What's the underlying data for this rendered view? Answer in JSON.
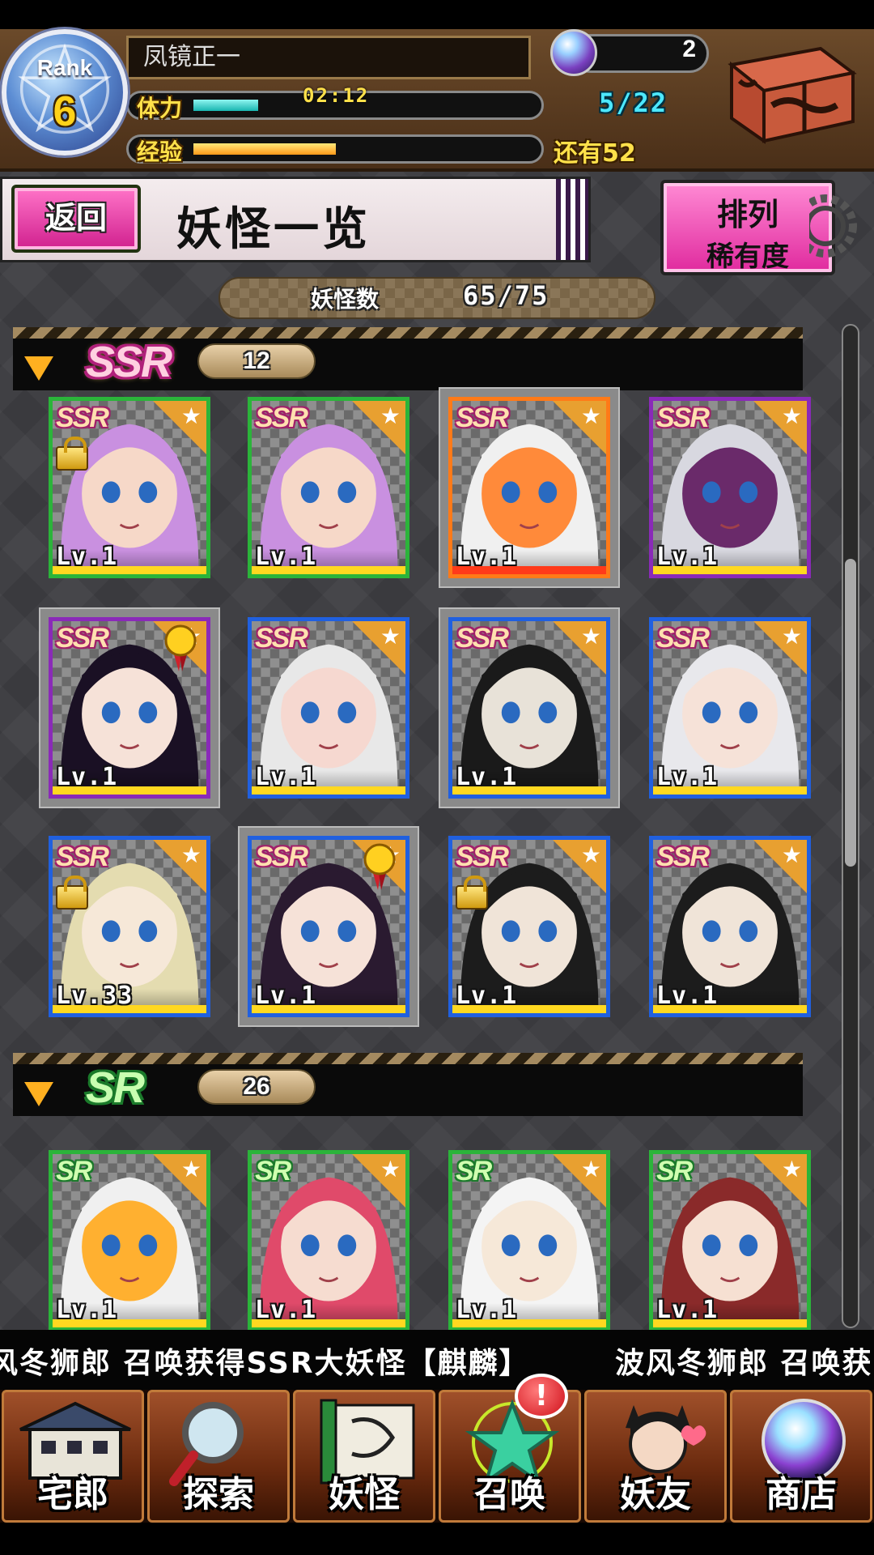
{
  "player": {
    "rank_label": "Rank",
    "rank_value": "6",
    "name": "凤镜正一",
    "stamina_label": "体力",
    "stamina_timer": "02:12",
    "stamina_fraction": 0.19,
    "exp_label": "经验",
    "exp_fraction": 0.42,
    "gems": "2",
    "summon_tickets": "5/22",
    "exp_remaining": "还有52"
  },
  "nav_top": {
    "back_label": "返回",
    "title": "妖怪一览",
    "sort_label_1": "排列",
    "sort_label_2": "稀有度"
  },
  "collection": {
    "label": "妖怪数",
    "value": "65/75"
  },
  "sections": [
    {
      "rarity": "SSR",
      "count": "12",
      "cards": [
        {
          "tag": "SSR",
          "level": "Lv.1",
          "frame": "green",
          "locked": true,
          "medal": false,
          "selected": false
        },
        {
          "tag": "SSR",
          "level": "Lv.1",
          "frame": "green",
          "locked": false,
          "medal": false,
          "selected": false
        },
        {
          "tag": "SSR",
          "level": "Lv.1",
          "frame": "orange",
          "locked": false,
          "medal": false,
          "selected": true
        },
        {
          "tag": "SSR",
          "level": "Lv.1",
          "frame": "purple",
          "locked": false,
          "medal": false,
          "selected": false
        },
        {
          "tag": "SSR",
          "level": "Lv.1",
          "frame": "purple",
          "locked": false,
          "medal": true,
          "selected": true
        },
        {
          "tag": "SSR",
          "level": "Lv.1",
          "frame": "blue",
          "locked": false,
          "medal": false,
          "selected": false
        },
        {
          "tag": "SSR",
          "level": "Lv.1",
          "frame": "blue",
          "locked": false,
          "medal": false,
          "selected": true
        },
        {
          "tag": "SSR",
          "level": "Lv.1",
          "frame": "blue",
          "locked": false,
          "medal": false,
          "selected": false
        },
        {
          "tag": "SSR",
          "level": "Lv.33",
          "frame": "blue",
          "locked": true,
          "medal": false,
          "selected": false
        },
        {
          "tag": "SSR",
          "level": "Lv.1",
          "frame": "blue",
          "locked": false,
          "medal": true,
          "selected": true
        },
        {
          "tag": "SSR",
          "level": "Lv.1",
          "frame": "blue",
          "locked": true,
          "medal": false,
          "selected": false
        },
        {
          "tag": "SSR",
          "level": "Lv.1",
          "frame": "blue",
          "locked": false,
          "medal": false,
          "selected": false
        }
      ]
    },
    {
      "rarity": "SR",
      "count": "26",
      "cards": [
        {
          "tag": "SR",
          "level": "Lv.1",
          "frame": "green",
          "locked": false,
          "medal": false,
          "selected": false
        },
        {
          "tag": "SR",
          "level": "Lv.1",
          "frame": "green",
          "locked": false,
          "medal": false,
          "selected": false
        },
        {
          "tag": "SR",
          "level": "Lv.1",
          "frame": "green",
          "locked": false,
          "medal": false,
          "selected": false
        },
        {
          "tag": "SR",
          "level": "Lv.1",
          "frame": "green",
          "locked": false,
          "medal": false,
          "selected": false
        }
      ]
    }
  ],
  "ticker": {
    "text": "风冬狮郎 召唤获得SSR大妖怪【麒麟】",
    "text2": "波风冬狮郎 召唤获"
  },
  "bottom_nav": [
    {
      "label": "宅郎",
      "icon": "house-icon"
    },
    {
      "label": "探索",
      "icon": "magnifier-icon"
    },
    {
      "label": "妖怪",
      "icon": "scroll-icon"
    },
    {
      "label": "召唤",
      "icon": "pentagram-icon"
    },
    {
      "label": "妖友",
      "icon": "friend-icon"
    },
    {
      "label": "商店",
      "icon": "orb-icon"
    }
  ],
  "alert_symbol": "!",
  "colors": {
    "accent_pink": "#e02a9e",
    "stamina": "#18b5b0",
    "exp": "#ff9a1a",
    "frame_blue": "#2060e0",
    "frame_green": "#2bb43a",
    "frame_orange": "#ff7a18",
    "frame_purple": "#8a2ab8"
  }
}
